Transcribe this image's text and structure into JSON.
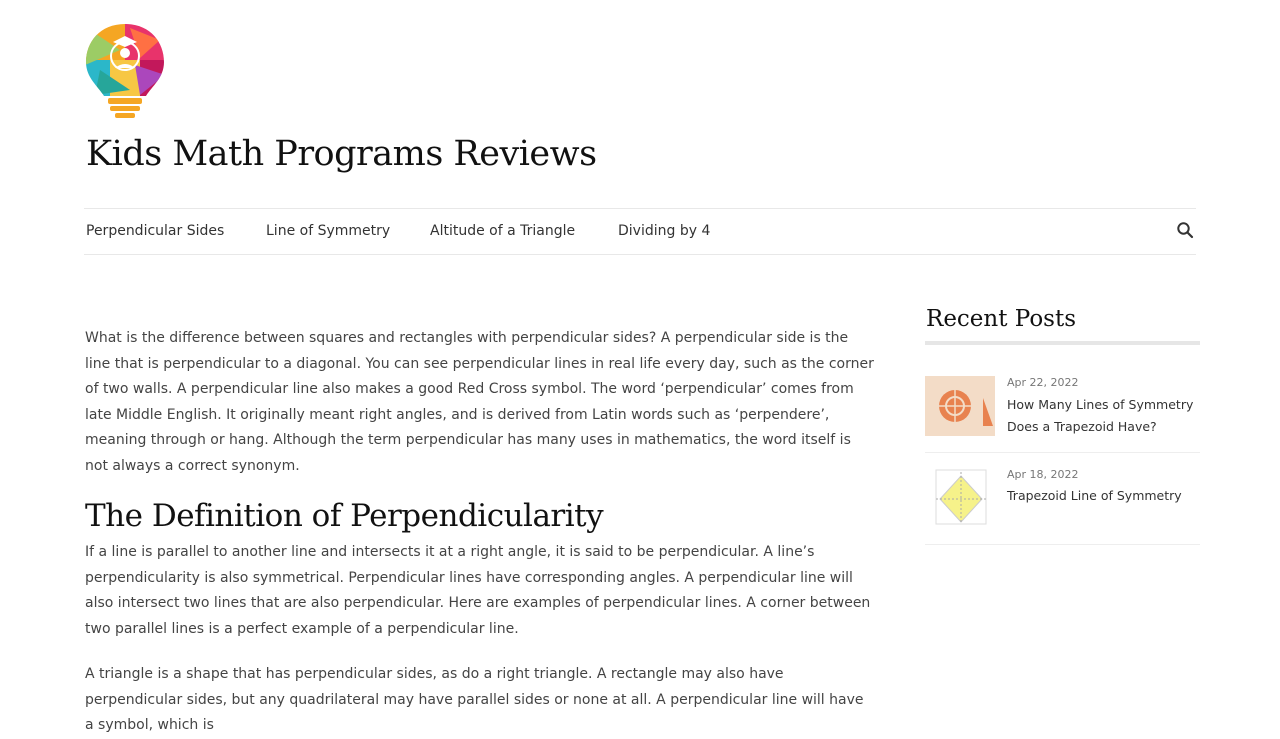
{
  "site": {
    "title": "Kids Math Programs Reviews",
    "tagline": ""
  },
  "nav": {
    "items": [
      {
        "label": "Perpendicular Sides"
      },
      {
        "label": "Line of Symmetry"
      },
      {
        "label": "Altitude of a Triangle"
      },
      {
        "label": "Dividing by 4"
      }
    ],
    "search_icon": "search-icon"
  },
  "article": {
    "intro": "What is the difference between squares and rectangles with perpendicular sides? A perpendicular side is the line that is perpendicular to a diagonal. You can see perpendicular lines in real life every day, such as the corner of two walls. A perpendicular line also makes a good Red Cross symbol. The word ‘perpendicular’ comes from late Middle English. It originally meant right angles, and is derived from Latin words such as ‘perpendere’, meaning through or hang. Although the term perpendicular has many uses in mathematics, the word itself is not always a correct synonym.",
    "heading": "The Definition of Perpendicularity",
    "para2": "If a line is parallel to another line and intersects it at a right angle, it is said to be perpendicular. A line’s perpendicularity is also symmetrical. Perpendicular lines have corresponding angles. A perpendicular line will also intersect two lines that are also perpendicular. Here are examples of perpendicular lines. A corner between two parallel lines is a perfect example of a perpendicular line.",
    "para3": "A triangle is a shape that has perpendicular sides, as do a right triangle. A rectangle may also have perpendicular sides, but any quadrilateral may have parallel sides or none at all. A perpendicular line will have a symbol, which is"
  },
  "sidebar": {
    "recent_title": "Recent Posts",
    "posts": [
      {
        "date": "Apr 22, 2022",
        "links": [
          "How Many Lines of Symmetry",
          "Does a Trapezoid Have?"
        ]
      },
      {
        "date": "Apr 18, 2022",
        "links": [
          "Trapezoid Line of Symmetry"
        ]
      }
    ]
  },
  "colors": {
    "text": "#444444",
    "heading": "#111111",
    "divider": "#e6e6e6"
  }
}
